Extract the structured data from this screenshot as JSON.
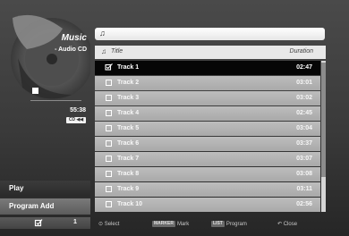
{
  "left_panel": {
    "title": "Music",
    "subtitle": "- Audio CD",
    "time": "55:38",
    "audio_badge": "CD ◀◀",
    "menu": {
      "play": "Play",
      "program_add": "Program Add"
    },
    "counter": "1"
  },
  "path_bar": {
    "icon": "music-note-icon"
  },
  "list": {
    "header_title": "Title",
    "header_duration": "Duration",
    "tracks": [
      {
        "title": "Track 1",
        "duration": "02:47",
        "selected": true
      },
      {
        "title": "Track 2",
        "duration": "03:01",
        "selected": false
      },
      {
        "title": "Track 3",
        "duration": "03:02",
        "selected": false
      },
      {
        "title": "Track 4",
        "duration": "02:45",
        "selected": false
      },
      {
        "title": "Track 5",
        "duration": "03:04",
        "selected": false
      },
      {
        "title": "Track 6",
        "duration": "03:37",
        "selected": false
      },
      {
        "title": "Track 7",
        "duration": "03:07",
        "selected": false
      },
      {
        "title": "Track 8",
        "duration": "03:08",
        "selected": false
      },
      {
        "title": "Track 9",
        "duration": "03:11",
        "selected": false
      },
      {
        "title": "Track 10",
        "duration": "02:56",
        "selected": false
      }
    ]
  },
  "help_bar": {
    "select_label": "Select",
    "marker_key": "MARKER",
    "mark_label": "Mark",
    "list_key": "LIST",
    "program_label": "Program",
    "close_label": "Close"
  },
  "colors": {
    "selected_row": "#060606",
    "row": "#b3b3b3",
    "header": "#e8e8e8"
  }
}
